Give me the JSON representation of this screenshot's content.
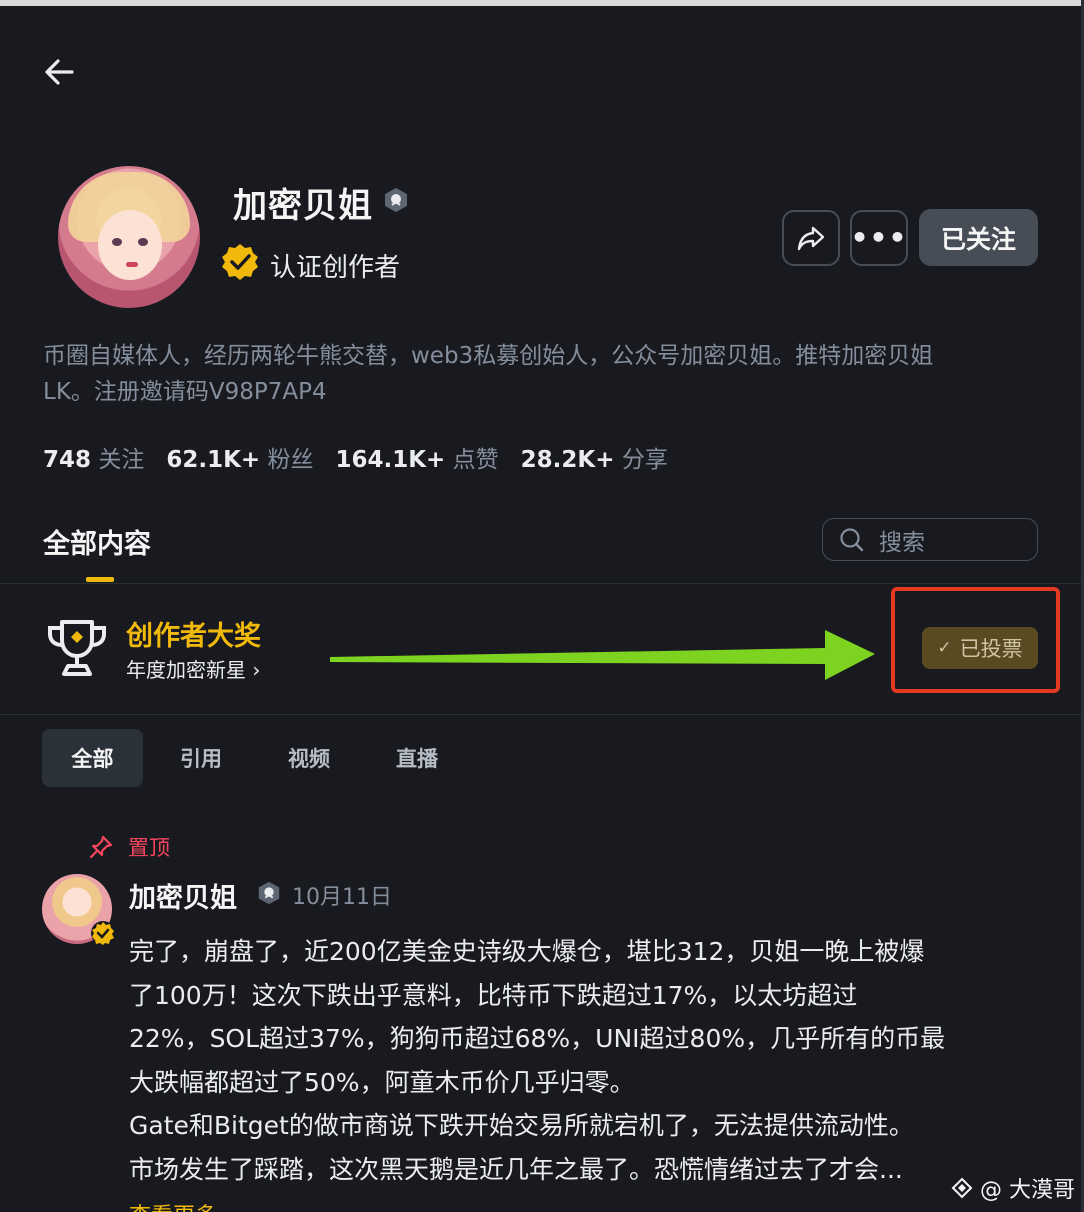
{
  "profile": {
    "name": "加密贝姐",
    "verified_label": "认证创作者",
    "follow_label": "已关注",
    "bio_line1": "币圈自媒体人，经历两轮牛熊交替，web3私募创始人，公众号加密贝姐。推特加密贝姐",
    "bio_line2": "LK。注册邀请码V98P7AP4"
  },
  "stats": [
    {
      "value": "748",
      "label": "关注"
    },
    {
      "value": "62.1K+",
      "label": "粉丝"
    },
    {
      "value": "164.1K+",
      "label": "点赞"
    },
    {
      "value": "28.2K+",
      "label": "分享"
    }
  ],
  "content_tab": "全部内容",
  "search": {
    "placeholder": "搜索"
  },
  "award": {
    "title": "创作者大奖",
    "subtitle": "年度加密新星 ›",
    "voted_label": "已投票",
    "check": "✓"
  },
  "filter_tabs": [
    "全部",
    "引用",
    "视频",
    "直播"
  ],
  "post": {
    "pinned_label": "置顶",
    "author": "加密贝姐",
    "date": "10月11日",
    "lines": [
      "完了，崩盘了，近200亿美金史诗级大爆仓，堪比312，贝姐一晚上被爆",
      "了100万！这次下跌出乎意料，比特币下跌超过17%，以太坊超过",
      "22%，SOL超过37%，狗狗币超过68%，UNI超过80%，几乎所有的币最",
      "大跌幅都超过了50%，阿童木币价几乎归零。",
      "Gate和Bitget的做市商说下跌开始交易所就宕机了，无法提供流动性。",
      "市场发生了踩踏，这次黑天鹅是近几年之最了。恐慌情绪过去了才会..."
    ],
    "more_label": "查看更多"
  },
  "watermark": "@ 大漠哥",
  "colors": {
    "background": "#181a20",
    "accent": "#f0b90b",
    "annotation_arrow": "#7ed321",
    "annotation_box": "#e53923",
    "pinned": "#f6465d"
  }
}
